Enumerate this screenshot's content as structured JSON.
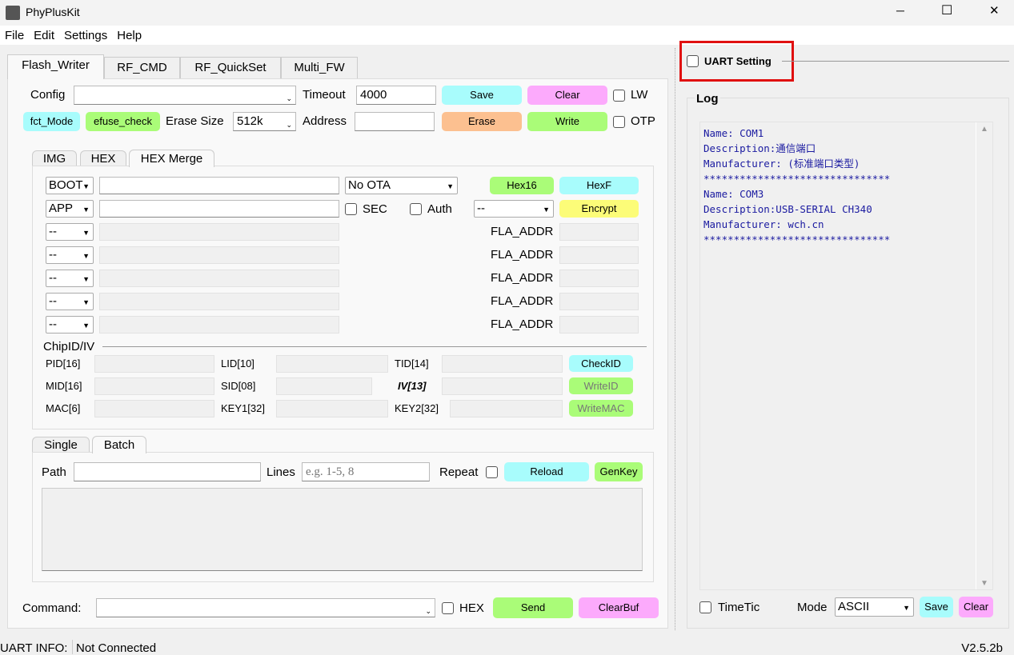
{
  "window": {
    "title": "PhyPlusKit",
    "minimize": "─",
    "maximize": "☐",
    "close": "✕"
  },
  "menu": [
    "File",
    "Edit",
    "Settings",
    "Help"
  ],
  "tabs": [
    "Flash_Writer",
    "RF_CMD",
    "RF_QuickSet",
    "Multi_FW"
  ],
  "flash": {
    "config_label": "Config",
    "config_value": "",
    "timeout_label": "Timeout",
    "timeout_value": "4000",
    "save": "Save",
    "clear": "Clear",
    "lw": "LW",
    "fct_mode": "fct_Mode",
    "efuse_check": "efuse_check",
    "erase_size_label": "Erase Size",
    "erase_size_value": "512k",
    "address_label": "Address",
    "address_value": "",
    "erase": "Erase",
    "write": "Write",
    "otp": "OTP"
  },
  "subtabs": [
    "IMG",
    "HEX",
    "HEX Merge"
  ],
  "merge": {
    "row1_type": "BOOT",
    "row2_type": "APP",
    "ota": "No OTA",
    "hex16": "Hex16",
    "hexf": "HexF",
    "sec": "SEC",
    "auth": "Auth",
    "encrypt_sel": "--",
    "encrypt": "Encrypt",
    "empty_type": "--",
    "fla_addr": "FLA_ADDR"
  },
  "chip": {
    "title": "ChipID/IV",
    "pid": "PID[16]",
    "lid": "LID[10]",
    "tid": "TID[14]",
    "mid": "MID[16]",
    "sid": "SID[08]",
    "iv": "IV[13]",
    "mac": "MAC[6]",
    "key1": "KEY1[32]",
    "key2": "KEY2[32]",
    "checkid": "CheckID",
    "writeid": "WriteID",
    "writemac": "WriteMAC"
  },
  "modetabs": [
    "Single",
    "Batch"
  ],
  "batch": {
    "path_label": "Path",
    "lines_label": "Lines",
    "lines_placeholder": "e.g. 1-5, 8",
    "repeat": "Repeat",
    "reload": "Reload",
    "genkey": "GenKey"
  },
  "command": {
    "label": "Command:",
    "hex": "HEX",
    "send": "Send",
    "clearbuf": "ClearBuf"
  },
  "uart": {
    "label": "UART Setting",
    "highlight_color": "#e01010"
  },
  "log": {
    "title": "Log",
    "lines": [
      "Name: COM1",
      "Description:通信端口",
      "Manufacturer: (标准端口类型)",
      "*******************************",
      "Name: COM3",
      "Description:USB-SERIAL CH340",
      "Manufacturer: wch.cn",
      "*******************************"
    ],
    "timetic": "TimeTic",
    "mode_label": "Mode",
    "mode_value": "ASCII",
    "save": "Save",
    "clear": "Clear"
  },
  "status": {
    "label": "UART INFO:",
    "value": "Not Connected",
    "version": "V2.5.2b"
  },
  "colors": {
    "cyan": "#a8fcfc",
    "pink": "#fcaafc",
    "green": "#aafc78",
    "orange": "#fcc090",
    "yellow": "#fcfc78"
  }
}
